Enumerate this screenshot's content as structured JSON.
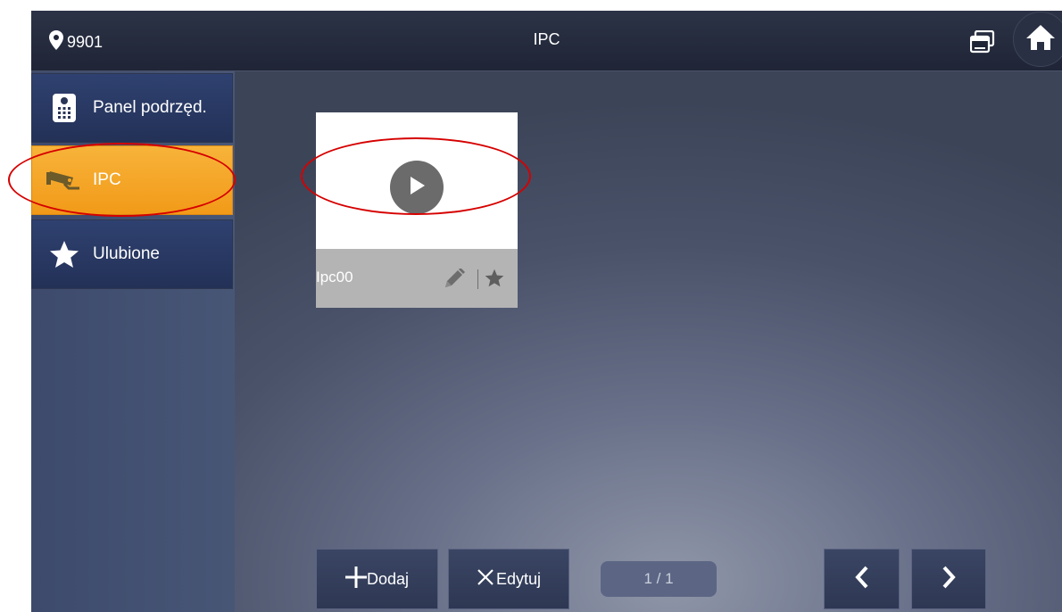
{
  "header": {
    "location_icon": "map-pin-icon",
    "location": "9901",
    "title": "IPC",
    "window_icon": "multi-window-icon",
    "home_icon": "home-icon"
  },
  "sidebar": {
    "items": [
      {
        "label": "Panel podrzęd.",
        "icon": "door-panel-icon",
        "active": false
      },
      {
        "label": "IPC",
        "icon": "camera-icon",
        "active": true
      },
      {
        "label": "Ulubione",
        "icon": "star-icon",
        "active": false
      }
    ]
  },
  "main": {
    "cards": [
      {
        "name": "Ipc00",
        "play_icon": "play-icon",
        "edit_icon": "pencil-icon",
        "favorite_icon": "star-icon"
      }
    ]
  },
  "footer": {
    "add_label": "Dodaj",
    "edit_label": "Edytuj",
    "page": "1 / 1",
    "prev_icon": "chevron-left-icon",
    "next_icon": "chevron-right-icon"
  },
  "colors": {
    "active_tab": "#f5a623",
    "annotation": "#d60000",
    "header_bg": "#1f2536"
  }
}
